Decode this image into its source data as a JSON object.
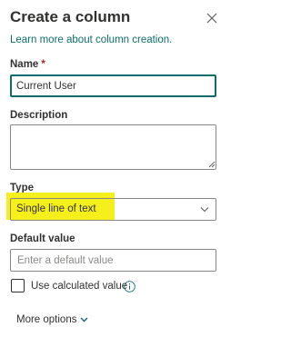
{
  "panel": {
    "title": "Create a column",
    "learn_more": "Learn more about column creation.",
    "close_icon": "close-icon"
  },
  "name_field": {
    "label": "Name",
    "required_marker": "*",
    "value": "Current User",
    "highlighted": true
  },
  "description_field": {
    "label": "Description",
    "value": ""
  },
  "type_field": {
    "label": "Type",
    "selected": "Single line of text",
    "icon": "chevron-down-icon",
    "highlighted": true
  },
  "default_field": {
    "label": "Default value",
    "placeholder": "Enter a default value",
    "value": ""
  },
  "calculated": {
    "label": "Use calculated value",
    "checked": false,
    "icon": "info-icon"
  },
  "more_options": {
    "label": "More options",
    "icon": "chevron-down-icon"
  },
  "colors": {
    "accent": "#0f6c6c",
    "highlight": "#f5ef1b",
    "required": "#a4262c",
    "text": "#323130",
    "border": "#8a8886"
  }
}
